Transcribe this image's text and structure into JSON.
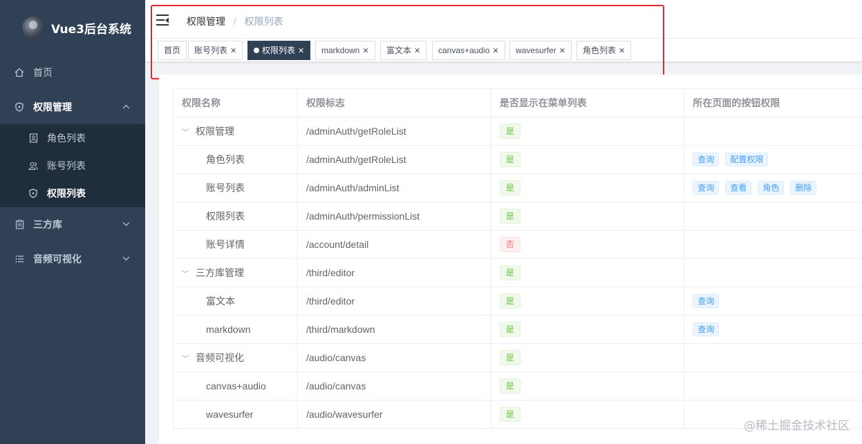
{
  "app": {
    "title": "Vue3后台系统"
  },
  "sidebar": {
    "items": [
      {
        "label": "首页",
        "icon": "home-icon"
      },
      {
        "label": "权限管理",
        "icon": "shield-icon"
      },
      {
        "label": "三方库",
        "icon": "clipboard-icon"
      },
      {
        "label": "音频可视化",
        "icon": "list-icon"
      }
    ],
    "sub_items": [
      {
        "label": "角色列表",
        "icon": "user-card-icon"
      },
      {
        "label": "账号列表",
        "icon": "users-icon"
      },
      {
        "label": "权限列表",
        "icon": "shield-icon"
      }
    ]
  },
  "breadcrumb": {
    "first": "权限管理",
    "separator": "/",
    "current": "权限列表"
  },
  "tags": [
    {
      "label": "首页",
      "closable": false
    },
    {
      "label": "账号列表",
      "closable": true
    },
    {
      "label": "权限列表",
      "closable": true,
      "active": true
    },
    {
      "label": "markdown",
      "closable": true
    },
    {
      "label": "富文本",
      "closable": true
    },
    {
      "label": "canvas+audio",
      "closable": true
    },
    {
      "label": "wavesurfer",
      "closable": true
    },
    {
      "label": "角色列表",
      "closable": true
    }
  ],
  "table": {
    "headers": [
      "权限名称",
      "权限标志",
      "是否显示在菜单列表",
      "所在页面的按钮权限"
    ],
    "rows": [
      {
        "name": "权限管理",
        "path": "/adminAuth/getRoleList",
        "show": "是",
        "buttons": []
      },
      {
        "name": "角色列表",
        "path": "/adminAuth/getRoleList",
        "show": "是",
        "buttons": [
          "查询",
          "配置权限"
        ]
      },
      {
        "name": "账号列表",
        "path": "/adminAuth/adminList",
        "show": "是",
        "buttons": [
          "查询",
          "查看",
          "角色",
          "删除"
        ]
      },
      {
        "name": "权限列表",
        "path": "/adminAuth/permissionList",
        "show": "是",
        "buttons": []
      },
      {
        "name": "账号详情",
        "path": "/account/detail",
        "show": "否",
        "buttons": []
      },
      {
        "name": "三方库管理",
        "path": "/third/editor",
        "show": "是",
        "buttons": []
      },
      {
        "name": "富文本",
        "path": "/third/editor",
        "show": "是",
        "buttons": [
          "查询"
        ]
      },
      {
        "name": "markdown",
        "path": "/third/markdown",
        "show": "是",
        "buttons": [
          "查询"
        ]
      },
      {
        "name": "音频可视化",
        "path": "/audio/canvas",
        "show": "是",
        "buttons": []
      },
      {
        "name": "canvas+audio",
        "path": "/audio/canvas",
        "show": "是",
        "buttons": []
      },
      {
        "name": "wavesurfer",
        "path": "/audio/wavesurfer",
        "show": "是",
        "buttons": []
      }
    ]
  },
  "watermark": "@稀土掘金技术社区",
  "colors": {
    "sidebar_bg": "#304156",
    "submenu_bg": "#1f2d3d",
    "active_tag": "#304156",
    "highlight": "#e5262c"
  }
}
